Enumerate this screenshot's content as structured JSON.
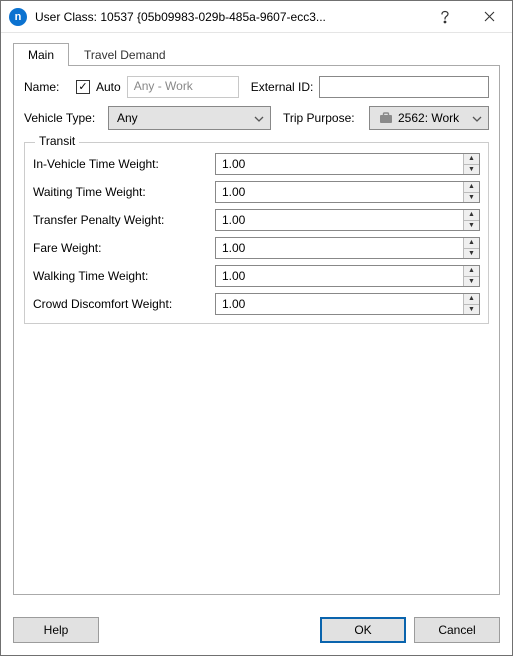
{
  "titlebar": {
    "title": "User Class: 10537  {05b09983-029b-485a-9607-ecc3..."
  },
  "tabs": {
    "main": "Main",
    "travel_demand": "Travel Demand"
  },
  "form": {
    "name_label": "Name:",
    "auto_label": "Auto",
    "auto_checked": "✓",
    "name_value": "Any - Work",
    "external_id_label": "External ID:",
    "external_id_value": "",
    "vehicle_type_label": "Vehicle Type:",
    "vehicle_type_value": "Any",
    "trip_purpose_label": "Trip Purpose:",
    "trip_purpose_value": "2562: Work"
  },
  "transit": {
    "legend": "Transit",
    "rows": [
      {
        "label": "In-Vehicle Time Weight:",
        "value": "1.00"
      },
      {
        "label": "Waiting Time Weight:",
        "value": "1.00"
      },
      {
        "label": "Transfer Penalty Weight:",
        "value": "1.00"
      },
      {
        "label": "Fare Weight:",
        "value": "1.00"
      },
      {
        "label": "Walking Time Weight:",
        "value": "1.00"
      },
      {
        "label": "Crowd Discomfort Weight:",
        "value": "1.00"
      }
    ]
  },
  "buttons": {
    "help": "Help",
    "ok": "OK",
    "cancel": "Cancel"
  }
}
